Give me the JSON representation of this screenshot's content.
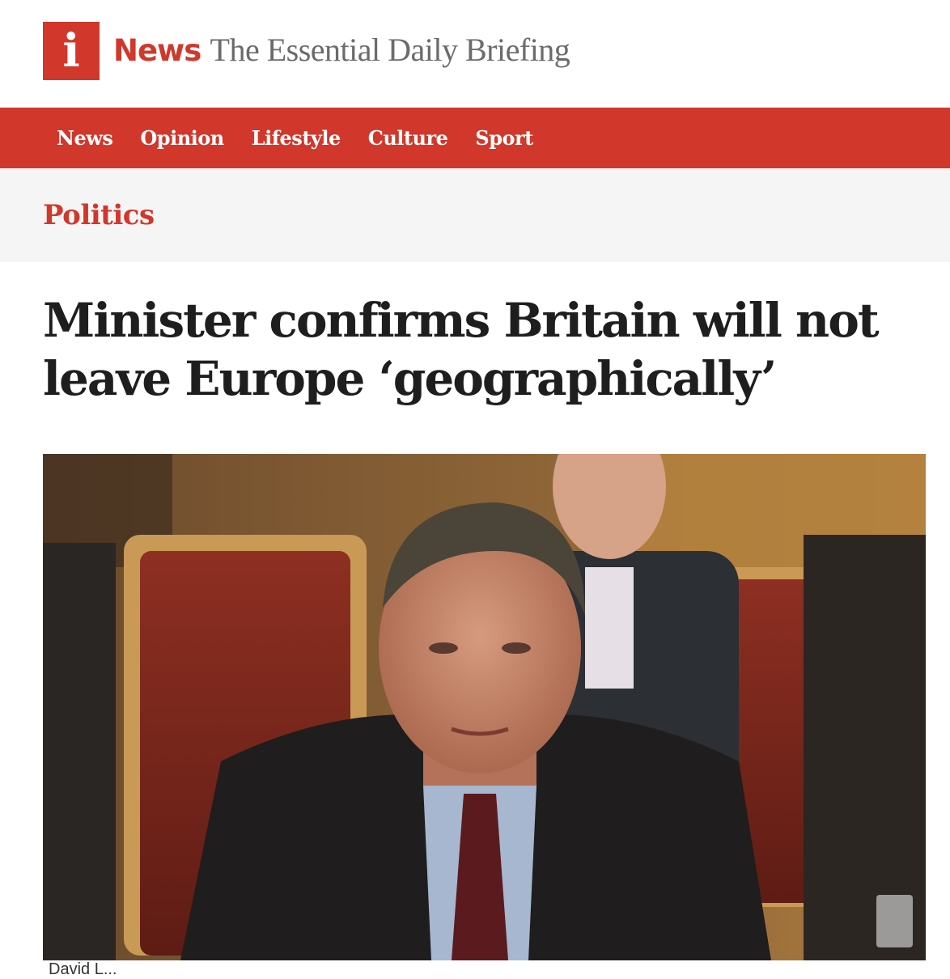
{
  "masthead": {
    "logo_letter": "i",
    "brand_name": "News",
    "tagline": "The Essential Daily Briefing"
  },
  "nav": {
    "items": [
      {
        "label": "News"
      },
      {
        "label": "Opinion"
      },
      {
        "label": "Lifestyle"
      },
      {
        "label": "Culture"
      },
      {
        "label": "Sport"
      }
    ]
  },
  "section": {
    "label": "Politics"
  },
  "article": {
    "headline": "Minister confirms Britain will not leave Europe ‘geographically’",
    "image_caption": "David L..."
  },
  "colors": {
    "brand_red": "#d1372b",
    "section_bg": "#f5f5f5",
    "headline": "#1e1e1e",
    "tagline": "#6b6b6b"
  }
}
